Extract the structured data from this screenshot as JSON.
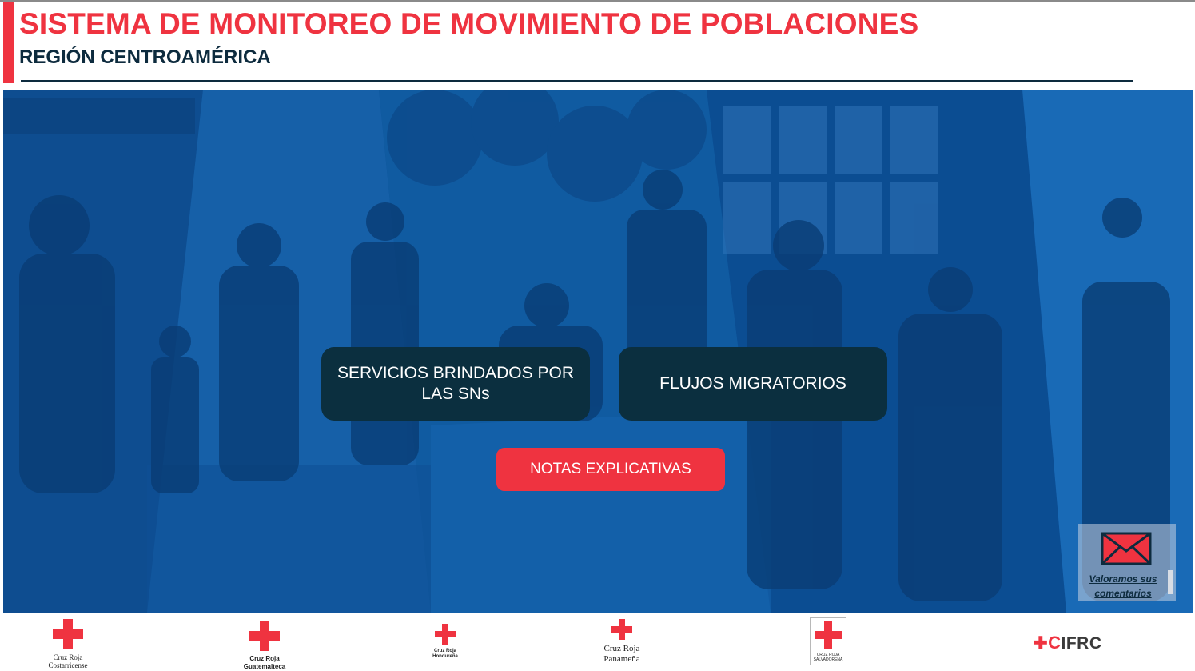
{
  "header": {
    "title": "SISTEMA DE MONITOREO DE MOVIMIENTO DE POBLACIONES",
    "subtitle": "REGIÓN CENTROAMÉRICA"
  },
  "buttons": {
    "servicios_line1": "SERVICIOS BRINDADOS POR",
    "servicios_line2": "LAS SNs",
    "flujos": "FLUJOS MIGRATORIOS",
    "notas": "NOTAS EXPLICATIVAS"
  },
  "feedback": {
    "line1": "Valoramos sus",
    "line2": "comentarios",
    "icon": "envelope-icon"
  },
  "footer": {
    "logos": [
      {
        "line1": "Cruz Roja",
        "line2": "Costarricense"
      },
      {
        "line1": "Cruz Roja",
        "line2": "Guatemalteca"
      },
      {
        "line1": "Cruz Roja",
        "line2": "Hondureña"
      },
      {
        "line1": "Cruz Roja",
        "line2": "Panameña"
      },
      {
        "line1": "CRUZ ROJA",
        "line2": "SALVADOREÑA"
      }
    ],
    "ifrc": "IFRC"
  },
  "colors": {
    "accent": "#ef3340",
    "navy": "#0d2b3e",
    "button_dark": "#0b2f3f",
    "hero_blue": "#0b4f94"
  }
}
